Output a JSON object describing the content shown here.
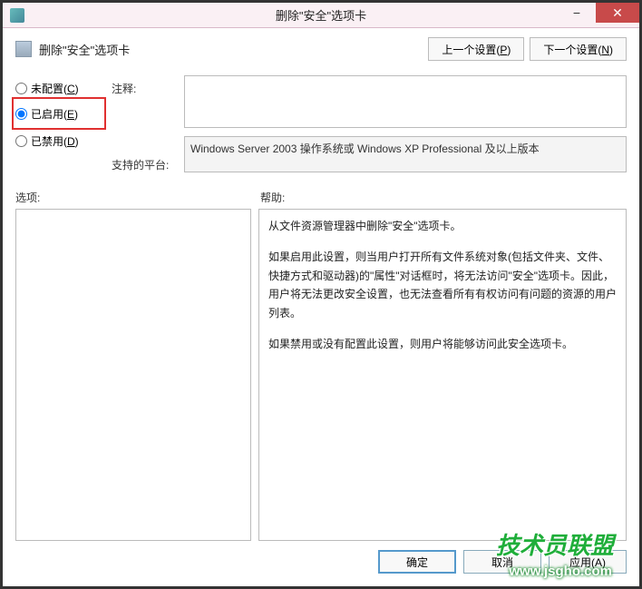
{
  "titlebar": {
    "title": "删除\"安全\"选项卡"
  },
  "header": {
    "policy_title": "删除\"安全\"选项卡"
  },
  "nav": {
    "prev": "上一个设置(P)",
    "prev_key": "P",
    "next": "下一个设置(N)",
    "next_key": "N"
  },
  "radios": {
    "not_configured": "未配置(C)",
    "not_configured_key": "C",
    "enabled": "已启用(E)",
    "enabled_key": "E",
    "disabled": "已禁用(D)",
    "disabled_key": "D",
    "selected": "enabled"
  },
  "labels": {
    "comment": "注释:",
    "platform": "支持的平台:",
    "options": "选项:",
    "help": "帮助:"
  },
  "platform_text": "Windows Server 2003 操作系统或 Windows XP Professional 及以上版本",
  "help": {
    "p1": "从文件资源管理器中删除\"安全\"选项卡。",
    "p2": "如果启用此设置，则当用户打开所有文件系统对象(包括文件夹、文件、快捷方式和驱动器)的\"属性\"对话框时，将无法访问\"安全\"选项卡。因此，用户将无法更改安全设置，也无法查看所有有权访问有问题的资源的用户列表。",
    "p3": "如果禁用或没有配置此设置，则用户将能够访问此安全选项卡。"
  },
  "buttons": {
    "ok": "确定",
    "cancel": "取消",
    "apply": "应用(A)"
  },
  "watermark": {
    "line1": "技术员联盟",
    "line2": "www.jsgho.com"
  }
}
